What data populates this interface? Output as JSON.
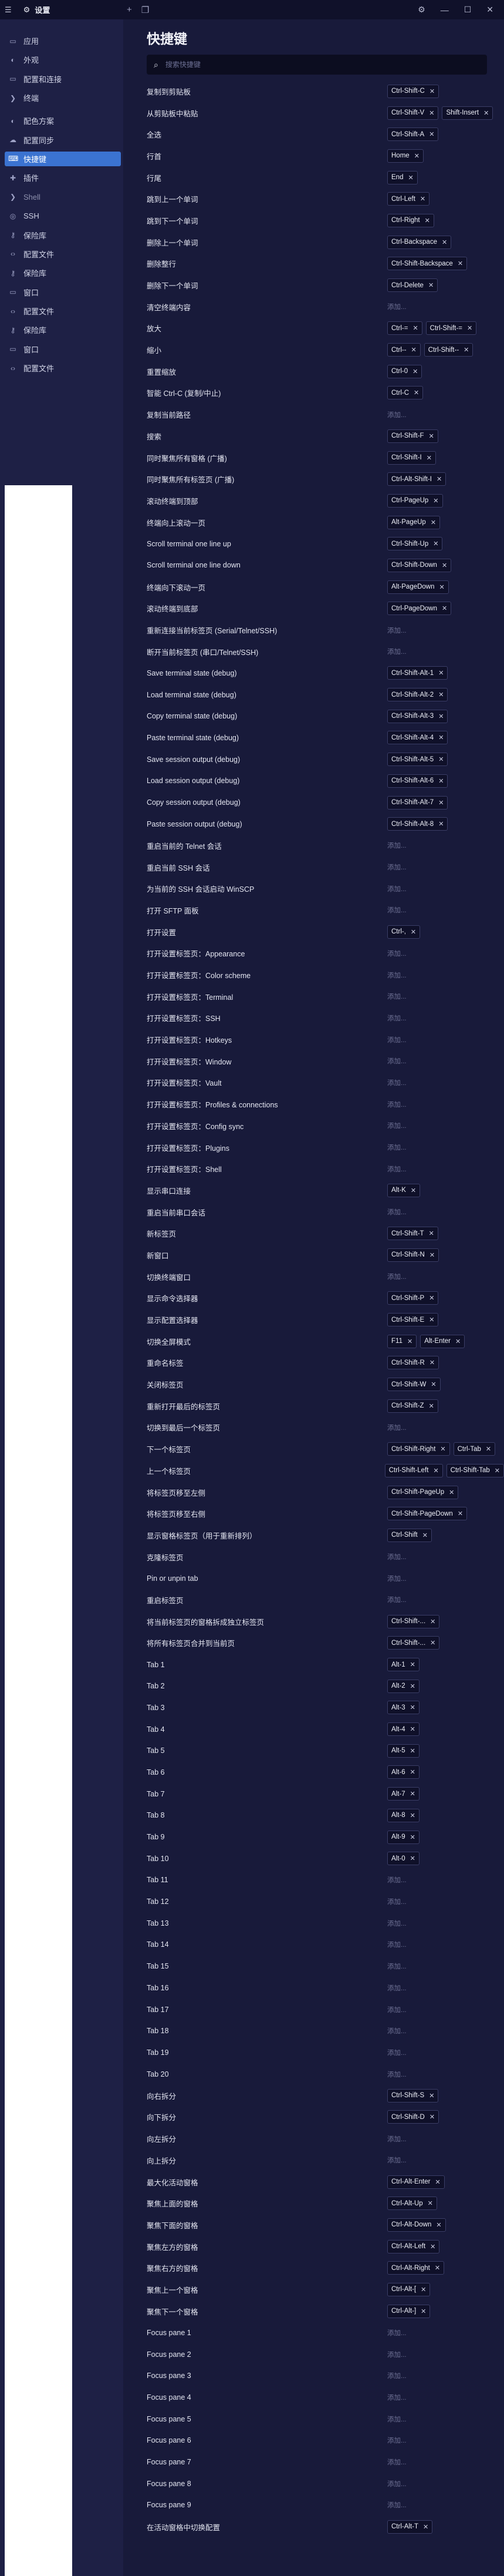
{
  "titlebar": {
    "title": "设置",
    "menu_icon": "hamburger-icon",
    "new_tab": "+",
    "settings_icon": "gear-icon"
  },
  "sidebar": [
    {
      "label": "应用",
      "icon": "window-icon"
    },
    {
      "label": "外观",
      "icon": "palette-icon"
    },
    {
      "label": "配置和连接",
      "icon": "window-icon"
    },
    {
      "label": "终端",
      "icon": "terminal-icon"
    },
    {
      "label": "配色方案",
      "icon": "palette-icon"
    },
    {
      "label": "配置同步",
      "icon": "cloud-icon"
    },
    {
      "label": "快捷键",
      "icon": "keyboard-icon",
      "active": true
    },
    {
      "label": "插件",
      "icon": "puzzle-icon"
    },
    {
      "label": "Shell",
      "icon": "terminal-icon",
      "dim": true
    },
    {
      "label": "SSH",
      "icon": "globe-icon"
    },
    {
      "label": "保险库",
      "icon": "key-icon"
    },
    {
      "label": "配置文件",
      "icon": "code-icon"
    },
    {
      "label": "保险库",
      "icon": "key-icon"
    },
    {
      "label": "窗口",
      "icon": "window-icon"
    },
    {
      "label": "配置文件",
      "icon": "code-icon"
    },
    {
      "label": "保险库",
      "icon": "key-icon"
    },
    {
      "label": "窗口",
      "icon": "window-icon"
    },
    {
      "label": "配置文件",
      "icon": "code-icon"
    }
  ],
  "main": {
    "title": "快捷键",
    "search_placeholder": "搜索快捷键",
    "add_label": "添加..."
  },
  "rows": [
    {
      "label": "复制到剪贴板",
      "keys": [
        "Ctrl-Shift-C"
      ]
    },
    {
      "label": "从剪贴板中粘贴",
      "keys": [
        "Ctrl-Shift-V",
        "Shift-Insert"
      ]
    },
    {
      "label": "全选",
      "keys": [
        "Ctrl-Shift-A"
      ]
    },
    {
      "label": "行首",
      "keys": [
        "Home"
      ]
    },
    {
      "label": "行尾",
      "keys": [
        "End"
      ]
    },
    {
      "label": "跳到上一个单词",
      "keys": [
        "Ctrl-Left"
      ]
    },
    {
      "label": "跳到下一个单词",
      "keys": [
        "Ctrl-Right"
      ]
    },
    {
      "label": "删除上一个单词",
      "keys": [
        "Ctrl-Backspace"
      ]
    },
    {
      "label": "删除整行",
      "keys": [
        "Ctrl-Shift-Backspace"
      ]
    },
    {
      "label": "删除下一个单词",
      "keys": [
        "Ctrl-Delete"
      ]
    },
    {
      "label": "清空终端内容",
      "keys": []
    },
    {
      "label": "放大",
      "keys": [
        "Ctrl-=",
        "Ctrl-Shift-="
      ]
    },
    {
      "label": "缩小",
      "keys": [
        "Ctrl--",
        "Ctrl-Shift--"
      ]
    },
    {
      "label": "重置缩放",
      "keys": [
        "Ctrl-0"
      ]
    },
    {
      "label": "智能 Ctrl-C (复制/中止)",
      "keys": [
        "Ctrl-C"
      ]
    },
    {
      "label": "复制当前路径",
      "keys": []
    },
    {
      "label": "搜索",
      "keys": [
        "Ctrl-Shift-F"
      ]
    },
    {
      "label": "同时聚焦所有窗格 (广播)",
      "keys": [
        "Ctrl-Shift-I"
      ]
    },
    {
      "label": "同时聚焦所有标签页 (广播)",
      "keys": [
        "Ctrl-Alt-Shift-I"
      ]
    },
    {
      "label": "滚动终端到顶部",
      "keys": [
        "Ctrl-PageUp"
      ]
    },
    {
      "label": "终端向上滚动一页",
      "keys": [
        "Alt-PageUp"
      ]
    },
    {
      "label": "Scroll terminal one line up",
      "keys": [
        "Ctrl-Shift-Up"
      ]
    },
    {
      "label": "Scroll terminal one line down",
      "keys": [
        "Ctrl-Shift-Down"
      ]
    },
    {
      "label": "终端向下滚动一页",
      "keys": [
        "Alt-PageDown"
      ]
    },
    {
      "label": "滚动终端到底部",
      "keys": [
        "Ctrl-PageDown"
      ]
    },
    {
      "label": "重新连接当前标签页 (Serial/Telnet/SSH)",
      "keys": []
    },
    {
      "label": "断开当前标签页 (串口/Telnet/SSH)",
      "keys": []
    },
    {
      "label": "Save terminal state (debug)",
      "keys": [
        "Ctrl-Shift-Alt-1"
      ]
    },
    {
      "label": "Load terminal state (debug)",
      "keys": [
        "Ctrl-Shift-Alt-2"
      ]
    },
    {
      "label": "Copy terminal state (debug)",
      "keys": [
        "Ctrl-Shift-Alt-3"
      ]
    },
    {
      "label": "Paste terminal state (debug)",
      "keys": [
        "Ctrl-Shift-Alt-4"
      ]
    },
    {
      "label": "Save session output (debug)",
      "keys": [
        "Ctrl-Shift-Alt-5"
      ]
    },
    {
      "label": "Load session output (debug)",
      "keys": [
        "Ctrl-Shift-Alt-6"
      ]
    },
    {
      "label": "Copy session output (debug)",
      "keys": [
        "Ctrl-Shift-Alt-7"
      ]
    },
    {
      "label": "Paste session output (debug)",
      "keys": [
        "Ctrl-Shift-Alt-8"
      ]
    },
    {
      "label": "重启当前的 Telnet 会话",
      "keys": []
    },
    {
      "label": "重启当前 SSH 会话",
      "keys": []
    },
    {
      "label": "为当前的 SSH 会话启动 WinSCP",
      "keys": []
    },
    {
      "label": "打开 SFTP 面板",
      "keys": []
    },
    {
      "label": "打开设置",
      "keys": [
        "Ctrl-,"
      ]
    },
    {
      "label": "打开设置标签页：Appearance",
      "keys": []
    },
    {
      "label": "打开设置标签页：Color scheme",
      "keys": []
    },
    {
      "label": "打开设置标签页：Terminal",
      "keys": []
    },
    {
      "label": "打开设置标签页：SSH",
      "keys": []
    },
    {
      "label": "打开设置标签页：Hotkeys",
      "keys": []
    },
    {
      "label": "打开设置标签页：Window",
      "keys": []
    },
    {
      "label": "打开设置标签页：Vault",
      "keys": []
    },
    {
      "label": "打开设置标签页：Profiles & connections",
      "keys": []
    },
    {
      "label": "打开设置标签页：Config sync",
      "keys": []
    },
    {
      "label": "打开设置标签页：Plugins",
      "keys": []
    },
    {
      "label": "打开设置标签页：Shell",
      "keys": []
    },
    {
      "label": "显示串口连接",
      "keys": [
        "Alt-K"
      ]
    },
    {
      "label": "重启当前串口会话",
      "keys": []
    },
    {
      "label": "新标签页",
      "keys": [
        "Ctrl-Shift-T"
      ]
    },
    {
      "label": "新窗口",
      "keys": [
        "Ctrl-Shift-N"
      ]
    },
    {
      "label": "切换终端窗口",
      "keys": []
    },
    {
      "label": "显示命令选择器",
      "keys": [
        "Ctrl-Shift-P"
      ]
    },
    {
      "label": "显示配置选择器",
      "keys": [
        "Ctrl-Shift-E"
      ]
    },
    {
      "label": "切换全屏模式",
      "keys": [
        "F11",
        "Alt-Enter"
      ]
    },
    {
      "label": "重命名标签",
      "keys": [
        "Ctrl-Shift-R"
      ]
    },
    {
      "label": "关闭标签页",
      "keys": [
        "Ctrl-Shift-W"
      ]
    },
    {
      "label": "重新打开最后的标签页",
      "keys": [
        "Ctrl-Shift-Z"
      ]
    },
    {
      "label": "切换到最后一个标签页",
      "keys": []
    },
    {
      "label": "下一个标签页",
      "keys": [
        "Ctrl-Shift-Right",
        "Ctrl-Tab"
      ]
    },
    {
      "label": "上一个标签页",
      "keys": [
        "Ctrl-Shift-Left",
        "Ctrl-Shift-Tab"
      ]
    },
    {
      "label": "将标签页移至左侧",
      "keys": [
        "Ctrl-Shift-PageUp"
      ]
    },
    {
      "label": "将标签页移至右侧",
      "keys": [
        "Ctrl-Shift-PageDown"
      ]
    },
    {
      "label": "显示窗格标签页（用于重新排列）",
      "keys": [
        "Ctrl-Shift"
      ]
    },
    {
      "label": "克隆标签页",
      "keys": []
    },
    {
      "label": "Pin or unpin tab",
      "keys": []
    },
    {
      "label": "重启标签页",
      "keys": []
    },
    {
      "label": "将当前标签页的窗格拆成独立标签页",
      "keys": [
        "Ctrl-Shift-..."
      ]
    },
    {
      "label": "将所有标签页合并到当前页",
      "keys": [
        "Ctrl-Shift-..."
      ]
    },
    {
      "label": "Tab 1",
      "keys": [
        "Alt-1"
      ]
    },
    {
      "label": "Tab 2",
      "keys": [
        "Alt-2"
      ]
    },
    {
      "label": "Tab 3",
      "keys": [
        "Alt-3"
      ]
    },
    {
      "label": "Tab 4",
      "keys": [
        "Alt-4"
      ]
    },
    {
      "label": "Tab 5",
      "keys": [
        "Alt-5"
      ]
    },
    {
      "label": "Tab 6",
      "keys": [
        "Alt-6"
      ]
    },
    {
      "label": "Tab 7",
      "keys": [
        "Alt-7"
      ]
    },
    {
      "label": "Tab 8",
      "keys": [
        "Alt-8"
      ]
    },
    {
      "label": "Tab 9",
      "keys": [
        "Alt-9"
      ]
    },
    {
      "label": "Tab 10",
      "keys": [
        "Alt-0"
      ]
    },
    {
      "label": "Tab 11",
      "keys": []
    },
    {
      "label": "Tab 12",
      "keys": []
    },
    {
      "label": "Tab 13",
      "keys": []
    },
    {
      "label": "Tab 14",
      "keys": []
    },
    {
      "label": "Tab 15",
      "keys": []
    },
    {
      "label": "Tab 16",
      "keys": []
    },
    {
      "label": "Tab 17",
      "keys": []
    },
    {
      "label": "Tab 18",
      "keys": []
    },
    {
      "label": "Tab 19",
      "keys": []
    },
    {
      "label": "Tab 20",
      "keys": []
    },
    {
      "label": "向右拆分",
      "keys": [
        "Ctrl-Shift-S"
      ]
    },
    {
      "label": "向下拆分",
      "keys": [
        "Ctrl-Shift-D"
      ]
    },
    {
      "label": "向左拆分",
      "keys": []
    },
    {
      "label": "向上拆分",
      "keys": []
    },
    {
      "label": "最大化活动窗格",
      "keys": [
        "Ctrl-Alt-Enter"
      ]
    },
    {
      "label": "聚焦上面的窗格",
      "keys": [
        "Ctrl-Alt-Up"
      ]
    },
    {
      "label": "聚焦下面的窗格",
      "keys": [
        "Ctrl-Alt-Down"
      ]
    },
    {
      "label": "聚焦左方的窗格",
      "keys": [
        "Ctrl-Alt-Left"
      ]
    },
    {
      "label": "聚焦右方的窗格",
      "keys": [
        "Ctrl-Alt-Right"
      ]
    },
    {
      "label": "聚焦上一个窗格",
      "keys": [
        "Ctrl-Alt-["
      ]
    },
    {
      "label": "聚焦下一个窗格",
      "keys": [
        "Ctrl-Alt-]"
      ]
    },
    {
      "label": "Focus pane 1",
      "keys": []
    },
    {
      "label": "Focus pane 2",
      "keys": []
    },
    {
      "label": "Focus pane 3",
      "keys": []
    },
    {
      "label": "Focus pane 4",
      "keys": []
    },
    {
      "label": "Focus pane 5",
      "keys": []
    },
    {
      "label": "Focus pane 6",
      "keys": []
    },
    {
      "label": "Focus pane 7",
      "keys": []
    },
    {
      "label": "Focus pane 8",
      "keys": []
    },
    {
      "label": "Focus pane 9",
      "keys": []
    },
    {
      "label": "在活动窗格中切换配置",
      "keys": [
        "Ctrl-Alt-T"
      ]
    }
  ]
}
